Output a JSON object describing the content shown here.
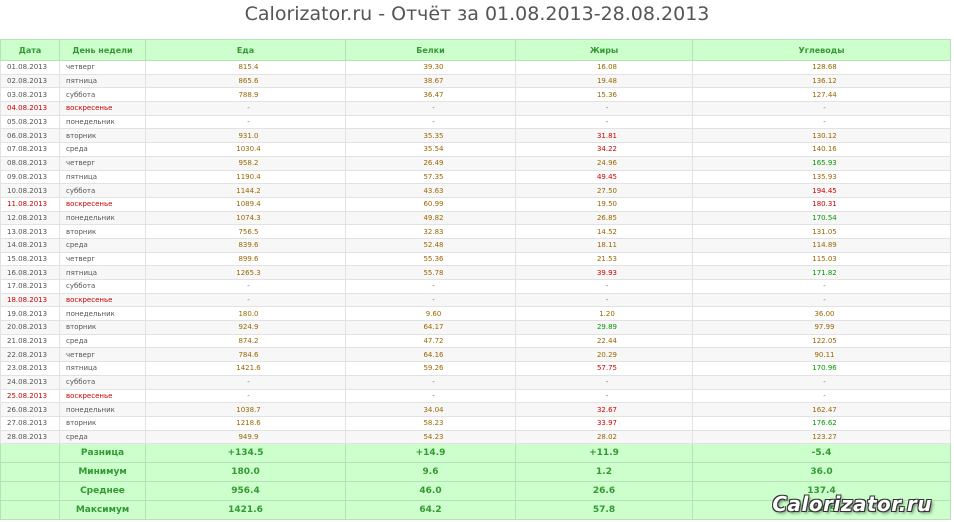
{
  "report": {
    "title": "Calorizator.ru - Отчёт за 01.08.2013-28.08.2013",
    "watermark": "Calorizator.ru",
    "colors": {
      "header_bg": "#ccffcc",
      "header_text": "#339933",
      "high": "#cc0000",
      "low": "#009900",
      "neutral": "#996600"
    }
  },
  "columns": [
    "Дата",
    "День недели",
    "Еда",
    "Белки",
    "Жиры",
    "Углеводы"
  ],
  "rows": [
    {
      "date": "01.08.2013",
      "dow": "четверг",
      "food": "815.4",
      "protein": "39.30",
      "fat": "16.08",
      "carbs": "128.68",
      "weekend": false,
      "fat_status": "neutral",
      "carbs_status": "neutral"
    },
    {
      "date": "02.08.2013",
      "dow": "пятница",
      "food": "865.6",
      "protein": "38.67",
      "fat": "19.48",
      "carbs": "136.12",
      "weekend": false,
      "fat_status": "neutral",
      "carbs_status": "neutral"
    },
    {
      "date": "03.08.2013",
      "dow": "суббота",
      "food": "788.9",
      "protein": "36.47",
      "fat": "15.36",
      "carbs": "127.44",
      "weekend": false,
      "fat_status": "neutral",
      "carbs_status": "neutral"
    },
    {
      "date": "04.08.2013",
      "dow": "воскресенье",
      "food": "-",
      "protein": "-",
      "fat": "-",
      "carbs": "-",
      "weekend": true,
      "fat_status": "dash",
      "carbs_status": "dash"
    },
    {
      "date": "05.08.2013",
      "dow": "понедельник",
      "food": "-",
      "protein": "-",
      "fat": "-",
      "carbs": "-",
      "weekend": false,
      "fat_status": "dash",
      "carbs_status": "dash"
    },
    {
      "date": "06.08.2013",
      "dow": "вторник",
      "food": "931.0",
      "protein": "35.35",
      "fat": "31.81",
      "carbs": "130.12",
      "weekend": false,
      "fat_status": "high",
      "carbs_status": "neutral"
    },
    {
      "date": "07.08.2013",
      "dow": "среда",
      "food": "1030.4",
      "protein": "35.54",
      "fat": "34.22",
      "carbs": "140.16",
      "weekend": false,
      "fat_status": "high",
      "carbs_status": "neutral"
    },
    {
      "date": "08.08.2013",
      "dow": "четверг",
      "food": "958.2",
      "protein": "26.49",
      "fat": "24.96",
      "carbs": "165.93",
      "weekend": false,
      "fat_status": "neutral",
      "carbs_status": "low"
    },
    {
      "date": "09.08.2013",
      "dow": "пятница",
      "food": "1190.4",
      "protein": "57.35",
      "fat": "49.45",
      "carbs": "135.93",
      "weekend": false,
      "fat_status": "high",
      "carbs_status": "neutral"
    },
    {
      "date": "10.08.2013",
      "dow": "суббота",
      "food": "1144.2",
      "protein": "43.63",
      "fat": "27.50",
      "carbs": "194.45",
      "weekend": false,
      "fat_status": "neutral",
      "carbs_status": "high"
    },
    {
      "date": "11.08.2013",
      "dow": "воскресенье",
      "food": "1089.4",
      "protein": "60.99",
      "fat": "19.50",
      "carbs": "180.31",
      "weekend": true,
      "fat_status": "neutral",
      "carbs_status": "high"
    },
    {
      "date": "12.08.2013",
      "dow": "понедельник",
      "food": "1074.3",
      "protein": "49.82",
      "fat": "26.85",
      "carbs": "170.54",
      "weekend": false,
      "fat_status": "neutral",
      "carbs_status": "low"
    },
    {
      "date": "13.08.2013",
      "dow": "вторник",
      "food": "756.5",
      "protein": "32.83",
      "fat": "14.52",
      "carbs": "131.05",
      "weekend": false,
      "fat_status": "neutral",
      "carbs_status": "neutral"
    },
    {
      "date": "14.08.2013",
      "dow": "среда",
      "food": "839.6",
      "protein": "52.48",
      "fat": "18.11",
      "carbs": "114.89",
      "weekend": false,
      "fat_status": "neutral",
      "carbs_status": "neutral"
    },
    {
      "date": "15.08.2013",
      "dow": "четверг",
      "food": "899.6",
      "protein": "55.36",
      "fat": "21.53",
      "carbs": "115.03",
      "weekend": false,
      "fat_status": "neutral",
      "carbs_status": "neutral"
    },
    {
      "date": "16.08.2013",
      "dow": "пятница",
      "food": "1265.3",
      "protein": "55.78",
      "fat": "39.93",
      "carbs": "171.82",
      "weekend": false,
      "fat_status": "high",
      "carbs_status": "low"
    },
    {
      "date": "17.08.2013",
      "dow": "суббота",
      "food": "-",
      "protein": "-",
      "fat": "-",
      "carbs": "-",
      "weekend": false,
      "fat_status": "dash",
      "carbs_status": "dash"
    },
    {
      "date": "18.08.2013",
      "dow": "воскресенье",
      "food": "-",
      "protein": "-",
      "fat": "-",
      "carbs": "-",
      "weekend": true,
      "fat_status": "dash",
      "carbs_status": "dash"
    },
    {
      "date": "19.08.2013",
      "dow": "понедельник",
      "food": "180.0",
      "protein": "9.60",
      "fat": "1.20",
      "carbs": "36.00",
      "weekend": false,
      "fat_status": "neutral",
      "carbs_status": "neutral"
    },
    {
      "date": "20.08.2013",
      "dow": "вторник",
      "food": "924.9",
      "protein": "64.17",
      "fat": "29.89",
      "carbs": "97.99",
      "weekend": false,
      "fat_status": "low",
      "carbs_status": "neutral"
    },
    {
      "date": "21.08.2013",
      "dow": "среда",
      "food": "874.2",
      "protein": "47.72",
      "fat": "22.44",
      "carbs": "122.05",
      "weekend": false,
      "fat_status": "neutral",
      "carbs_status": "neutral"
    },
    {
      "date": "22.08.2013",
      "dow": "четверг",
      "food": "784.6",
      "protein": "64.16",
      "fat": "20.29",
      "carbs": "90.11",
      "weekend": false,
      "fat_status": "neutral",
      "carbs_status": "neutral"
    },
    {
      "date": "23.08.2013",
      "dow": "пятница",
      "food": "1421.6",
      "protein": "59.26",
      "fat": "57.75",
      "carbs": "170.96",
      "weekend": false,
      "fat_status": "high",
      "carbs_status": "low"
    },
    {
      "date": "24.08.2013",
      "dow": "суббота",
      "food": "-",
      "protein": "-",
      "fat": "-",
      "carbs": "-",
      "weekend": false,
      "fat_status": "dash",
      "carbs_status": "dash"
    },
    {
      "date": "25.08.2013",
      "dow": "воскресенье",
      "food": "-",
      "protein": "-",
      "fat": "-",
      "carbs": "-",
      "weekend": true,
      "fat_status": "dash",
      "carbs_status": "dash"
    },
    {
      "date": "26.08.2013",
      "dow": "понедельник",
      "food": "1038.7",
      "protein": "34.04",
      "fat": "32.67",
      "carbs": "162.47",
      "weekend": false,
      "fat_status": "high",
      "carbs_status": "neutral"
    },
    {
      "date": "27.08.2013",
      "dow": "вторник",
      "food": "1218.6",
      "protein": "58.23",
      "fat": "33.97",
      "carbs": "176.62",
      "weekend": false,
      "fat_status": "high",
      "carbs_status": "low"
    },
    {
      "date": "28.08.2013",
      "dow": "среда",
      "food": "949.9",
      "protein": "54.23",
      "fat": "28.02",
      "carbs": "123.27",
      "weekend": false,
      "fat_status": "neutral",
      "carbs_status": "neutral"
    }
  ],
  "summary": [
    {
      "label": "Разница",
      "food": "+134.5",
      "protein": "+14.9",
      "fat": "+11.9",
      "carbs": "-5.4"
    },
    {
      "label": "Минимум",
      "food": "180.0",
      "protein": "9.6",
      "fat": "1.2",
      "carbs": "36.0"
    },
    {
      "label": "Среднее",
      "food": "956.4",
      "protein": "46.0",
      "fat": "26.6",
      "carbs": "137.4"
    },
    {
      "label": "Максимум",
      "food": "1421.6",
      "protein": "64.2",
      "fat": "57.8",
      "carbs": "194.5"
    }
  ]
}
